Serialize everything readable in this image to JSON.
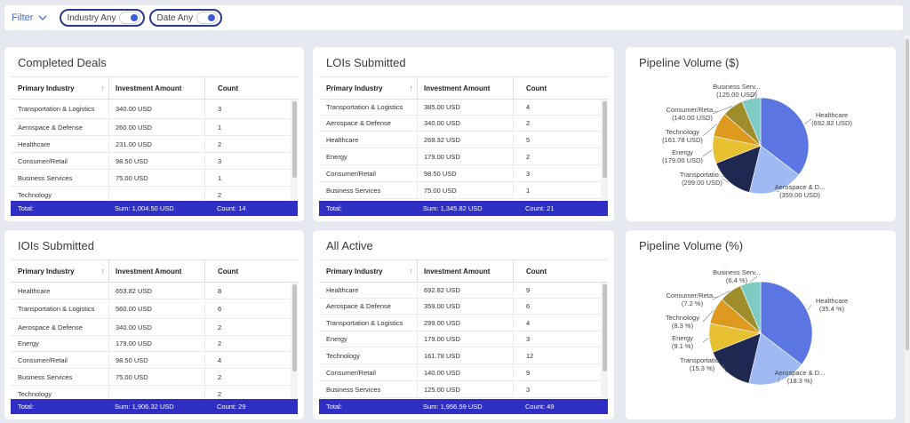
{
  "filterbar": {
    "filter_label": "Filter",
    "chips": [
      {
        "label": "Industry Any"
      },
      {
        "label": "Date Any"
      }
    ]
  },
  "tables": [
    {
      "title": "Completed Deals",
      "columns": [
        "Primary Industry",
        "Investment Amount",
        "Count"
      ],
      "rows": [
        {
          "industry": "Transportation & Logistics",
          "amount": "340.00 USD",
          "count": "3"
        },
        {
          "industry": "Aerospace & Defense",
          "amount": "260.00 USD",
          "count": "1"
        },
        {
          "industry": "Healthcare",
          "amount": "231.00 USD",
          "count": "2"
        },
        {
          "industry": "Consumer/Retail",
          "amount": "98.50 USD",
          "count": "3"
        },
        {
          "industry": "Business Services",
          "amount": "75.00 USD",
          "count": "1"
        },
        {
          "industry": "Technology",
          "amount": "",
          "count": "2"
        }
      ],
      "footer": {
        "label": "Total:",
        "sum": "Sum: 1,004.50 USD",
        "count": "Count: 14"
      }
    },
    {
      "title": "LOIs Submitted",
      "columns": [
        "Primary Industry",
        "Investment Amount",
        "Count"
      ],
      "rows": [
        {
          "industry": "Transportation & Logistics",
          "amount": "385.00 USD",
          "count": "4"
        },
        {
          "industry": "Aerospace & Defense",
          "amount": "340.00 USD",
          "count": "2"
        },
        {
          "industry": "Healthcare",
          "amount": "268.32 USD",
          "count": "5"
        },
        {
          "industry": "Energy",
          "amount": "179.00 USD",
          "count": "2"
        },
        {
          "industry": "Consumer/Retail",
          "amount": "98.50 USD",
          "count": "3"
        },
        {
          "industry": "Business Services",
          "amount": "75.00 USD",
          "count": "1"
        }
      ],
      "footer": {
        "label": "Total:",
        "sum": "Sum: 1,345.82 USD",
        "count": "Count: 21"
      }
    },
    {
      "title": "IOIs Submitted",
      "columns": [
        "Primary Industry",
        "Investment Amount",
        "Count"
      ],
      "rows": [
        {
          "industry": "Healthcare",
          "amount": "653.82 USD",
          "count": "8"
        },
        {
          "industry": "Transportation & Logistics",
          "amount": "560.00 USD",
          "count": "6"
        },
        {
          "industry": "Aerospace & Defense",
          "amount": "340.00 USD",
          "count": "2"
        },
        {
          "industry": "Energy",
          "amount": "179.00 USD",
          "count": "2"
        },
        {
          "industry": "Consumer/Retail",
          "amount": "98.50 USD",
          "count": "4"
        },
        {
          "industry": "Business Services",
          "amount": "75.00 USD",
          "count": "2"
        },
        {
          "industry": "Technology",
          "amount": "",
          "count": "2"
        }
      ],
      "footer": {
        "label": "Total:",
        "sum": "Sum: 1,906.32 USD",
        "count": "Count: 29"
      }
    },
    {
      "title": "All Active",
      "columns": [
        "Primary Industry",
        "Investment Amount",
        "Count"
      ],
      "rows": [
        {
          "industry": "Healthcare",
          "amount": "692.82 USD",
          "count": "9"
        },
        {
          "industry": "Aerospace & Defense",
          "amount": "359.00 USD",
          "count": "6"
        },
        {
          "industry": "Transportation & Logistics",
          "amount": "299.00 USD",
          "count": "4"
        },
        {
          "industry": "Energy",
          "amount": "179.00 USD",
          "count": "3"
        },
        {
          "industry": "Technology",
          "amount": "161.78 USD",
          "count": "12"
        },
        {
          "industry": "Consumer/Retail",
          "amount": "140.00 USD",
          "count": "9"
        },
        {
          "industry": "Business Services",
          "amount": "125.00 USD",
          "count": "3"
        }
      ],
      "footer": {
        "label": "Total:",
        "sum": "Sum: 1,956.59 USD",
        "count": "Count: 49"
      }
    }
  ],
  "chart_data": [
    {
      "type": "pie",
      "title": "Pipeline Volume ($)",
      "slices": [
        {
          "label": "Healthcare",
          "value": 692.82,
          "display": "(692.82 USD)",
          "color": "#5b76e2"
        },
        {
          "label": "Aerospace & D...",
          "value": 359.0,
          "display": "(359.00 USD)",
          "color": "#9fb9f3"
        },
        {
          "label": "Transportatio...",
          "value": 299.0,
          "display": "(299.00 USD)",
          "color": "#1f2850"
        },
        {
          "label": "Energy",
          "value": 179.0,
          "display": "(179.00 USD)",
          "color": "#e8c133"
        },
        {
          "label": "Technology",
          "value": 161.78,
          "display": "(161.78 USD)",
          "color": "#dd9a1e"
        },
        {
          "label": "Consumer/Reta...",
          "value": 140.0,
          "display": "(140.00 USD)",
          "color": "#9f8c2b"
        },
        {
          "label": "Business Serv...",
          "value": 125.0,
          "display": "(125.00 USD)",
          "color": "#7ecbc4"
        }
      ]
    },
    {
      "type": "pie",
      "title": "Pipeline Volume (%)",
      "slices": [
        {
          "label": "Healthcare",
          "value": 35.4,
          "display": "(35.4 %)",
          "color": "#5b76e2"
        },
        {
          "label": "Aerospace & D...",
          "value": 18.3,
          "display": "(18.3 %)",
          "color": "#9fb9f3"
        },
        {
          "label": "Transportatio...",
          "value": 15.3,
          "display": "(15.3 %)",
          "color": "#1f2850"
        },
        {
          "label": "Energy",
          "value": 9.1,
          "display": "(9.1 %)",
          "color": "#e8c133"
        },
        {
          "label": "Technology",
          "value": 8.3,
          "display": "(8.3 %)",
          "color": "#dd9a1e"
        },
        {
          "label": "Consumer/Reta...",
          "value": 7.2,
          "display": "(7.2 %)",
          "color": "#9f8c2b"
        },
        {
          "label": "Business Serv...",
          "value": 6.4,
          "display": "(6.4 %)",
          "color": "#7ecbc4"
        }
      ]
    }
  ]
}
